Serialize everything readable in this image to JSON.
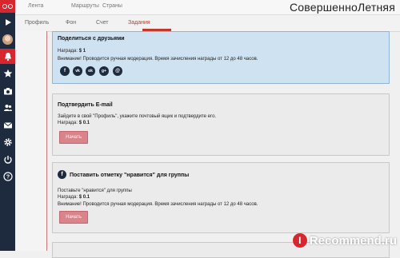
{
  "topnav": {
    "items": [
      "Лента",
      "Маршруты",
      "Страны"
    ],
    "site_title": "СовершенноЛетняя"
  },
  "subnav": {
    "tabs": [
      "Профиль",
      "Фон",
      "Счет",
      "Задания"
    ],
    "active_tab": "Задания"
  },
  "sidebar": {
    "icons": [
      "logo-icon",
      "play-icon",
      "avatar",
      "bell-icon",
      "star-icon",
      "camera-icon",
      "users-icon",
      "mail-icon",
      "gear-icon",
      "power-icon",
      "help-icon"
    ]
  },
  "tasks": [
    {
      "title": "Поделиться с друзьями",
      "reward_label": "Награда:",
      "reward_value": "$ 1",
      "note": "Внимание! Проводится ручная модерация. Время зачисления награды от 12 до 48 часов.",
      "social": [
        "f",
        "vk",
        "ok",
        "g+",
        "@"
      ]
    },
    {
      "title": "Подтвердить E-mail",
      "description": "Зайдите в свой \"Профиль\", укажите почтовый ящик и подтвердите его.",
      "reward_label": "Награда:",
      "reward_value": "$ 0.1",
      "button": "Начать"
    },
    {
      "title": "Поставить отметку \"нравится\" для группы",
      "description": "Поставьте \"нравится\" для группы",
      "reward_label": "Награда:",
      "reward_value": "$ 0.1",
      "note": "Внимание! Проводится ручная модерация. Время зачисления награды от 12 до 48 часов.",
      "button": "Начать"
    }
  ],
  "watermark": {
    "letter": "I",
    "text": "Recommend.ru"
  },
  "colors": {
    "accent": "#d8262f",
    "sidebar": "#1e2a3e",
    "button": "#d9838b",
    "highlight_card": "#cfe2f2"
  }
}
